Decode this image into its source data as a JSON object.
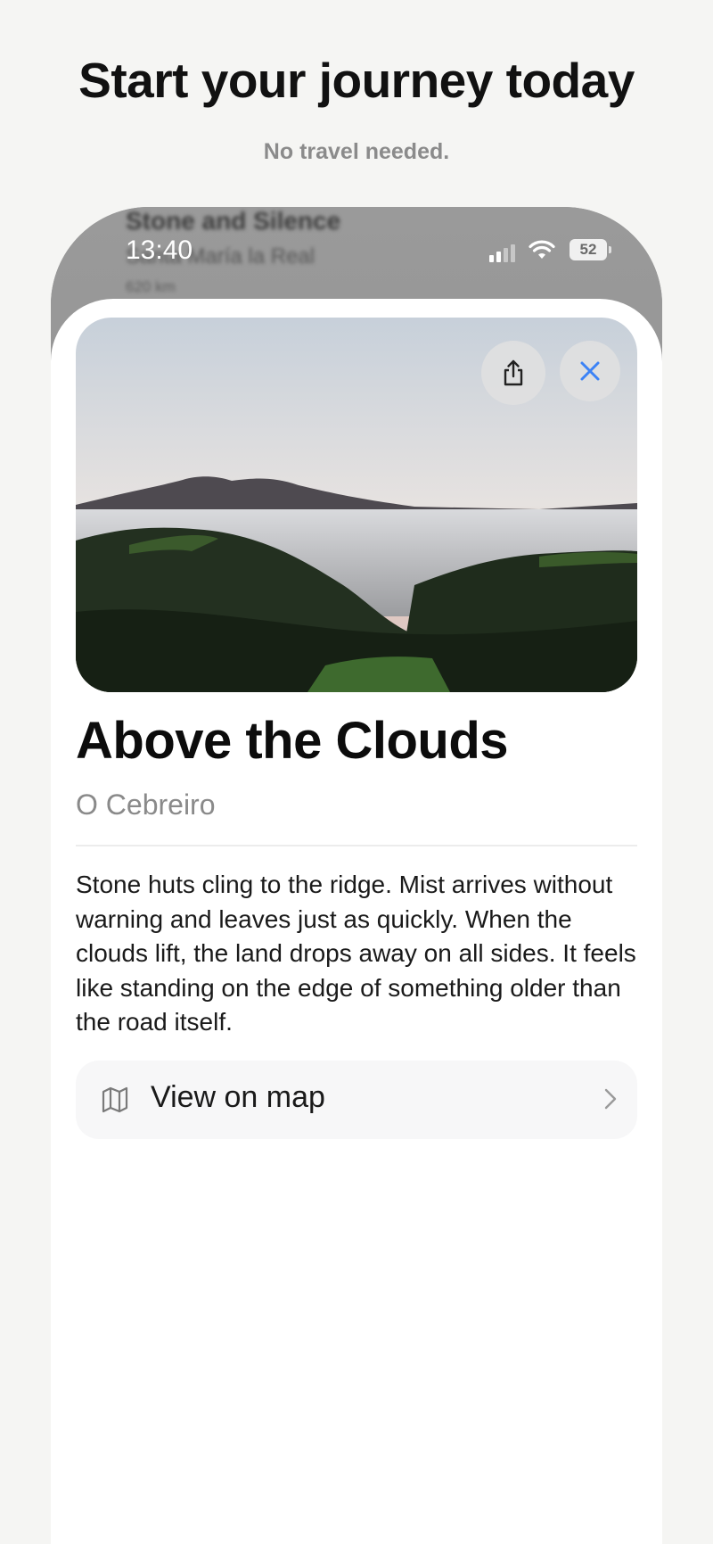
{
  "promo": {
    "headline": "Start your journey today",
    "subheadline": "No travel needed."
  },
  "background_card": {
    "title": "Stone and Silence",
    "subtitle": "Santa María la Real",
    "distance": "620 km"
  },
  "status_bar": {
    "time": "13:40",
    "battery": "52"
  },
  "detail": {
    "title": "Above the Clouds",
    "location": "O Cebreiro",
    "description": "Stone huts cling to the ridge. Mist arrives without warning and leaves just as quickly. When the clouds lift, the land drops away on all sides. It feels like standing on the edge of something older than the road itself.",
    "map_label": "View on map"
  },
  "colors": {
    "accent": "#3b82f6",
    "background": "#f5f5f3",
    "sheet": "#ffffff"
  },
  "icons": {
    "share": "share-icon",
    "close": "close-icon",
    "map": "map-icon",
    "chevron": "chevron-right-icon"
  }
}
